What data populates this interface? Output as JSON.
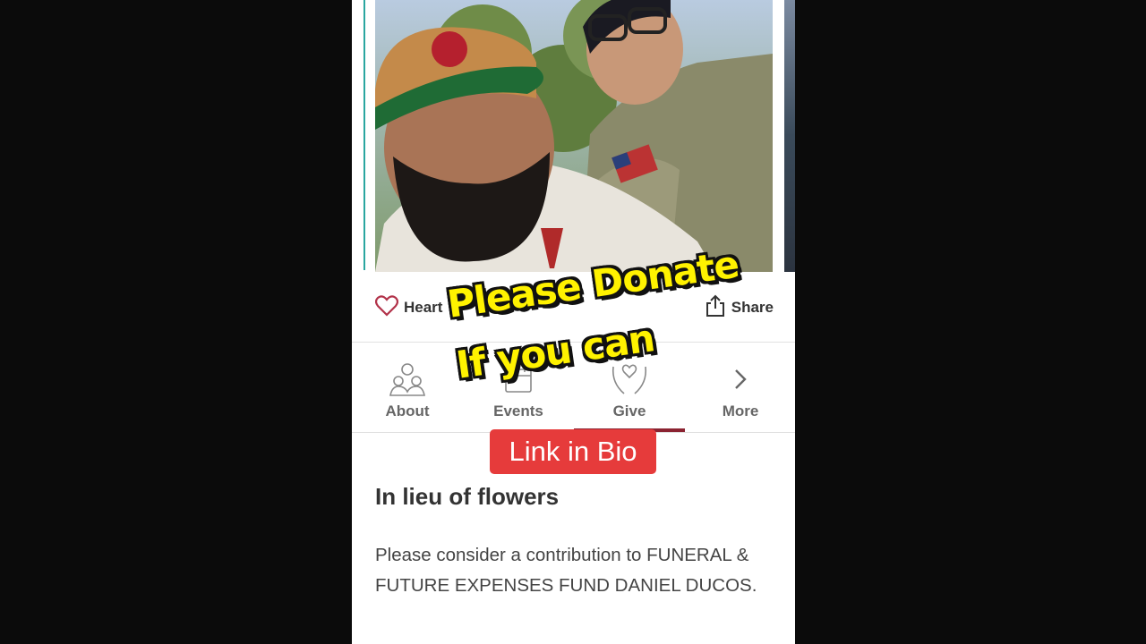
{
  "actions": {
    "heart_label": "Heart",
    "share_label": "Share"
  },
  "tabs": [
    {
      "label": "About",
      "icon": "people-icon"
    },
    {
      "label": "Events",
      "icon": "calendar-icon"
    },
    {
      "label": "Give",
      "icon": "hands-heart-icon",
      "active": true
    },
    {
      "label": "More",
      "icon": "chevron-right-icon"
    }
  ],
  "content": {
    "title": "In lieu of flowers",
    "body": "Please consider a contribution to FUNERAL & FUTURE EXPENSES FUND DANIEL DUCOS."
  },
  "overlay": {
    "line1": "Please Donate",
    "line2": "If you can",
    "link_button": "Link in Bio"
  },
  "colors": {
    "accent": "#8b2331",
    "link_button_bg": "#e63b3b",
    "overlay_text": "#fff200",
    "teal_edge": "#2aa6a0"
  }
}
